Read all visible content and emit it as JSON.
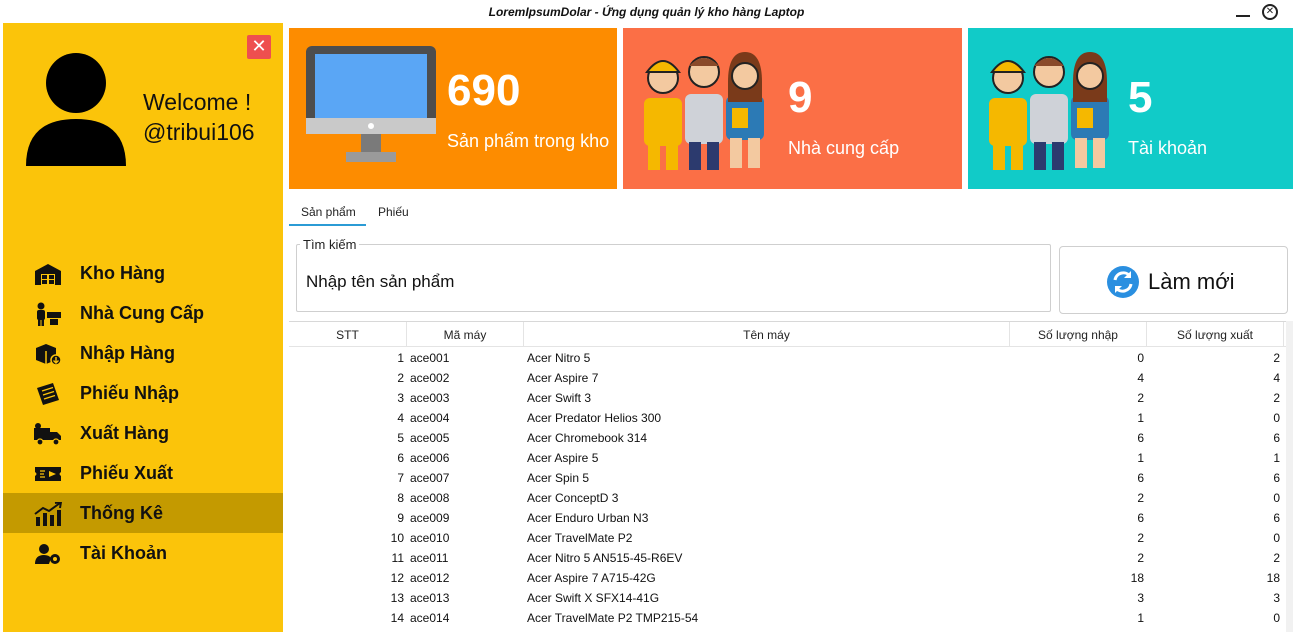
{
  "window": {
    "title": "LoremIpsumDolar - Ứng dụng quản lý kho hàng Laptop",
    "minimize_icon": "minimize-icon",
    "close_icon": "close-icon"
  },
  "sidebar": {
    "close_label": "✕",
    "welcome_line1": "Welcome !",
    "welcome_line2": "@tribui106",
    "items": [
      {
        "label": "Kho Hàng",
        "icon": "warehouse-icon"
      },
      {
        "label": "Nhà Cung Cấp",
        "icon": "supplier-icon"
      },
      {
        "label": "Nhập Hàng",
        "icon": "import-box-icon"
      },
      {
        "label": "Phiếu Nhập",
        "icon": "import-receipt-icon"
      },
      {
        "label": "Xuất Hàng",
        "icon": "delivery-truck-icon"
      },
      {
        "label": "Phiếu Xuất",
        "icon": "export-ticket-icon"
      },
      {
        "label": "Thống Kê",
        "icon": "statistics-chart-icon",
        "active": true
      },
      {
        "label": "Tài Khoản",
        "icon": "account-gear-icon"
      }
    ],
    "color": "#fbc40a",
    "active_color": "#c49a00"
  },
  "cards": [
    {
      "value": "690",
      "label": "Sản phẩm trong kho",
      "color": "#fd8c00",
      "icon": "monitor-icon"
    },
    {
      "value": "9",
      "label": "Nhà cung cấp",
      "color": "#fb6f46",
      "icon": "workers-group-icon"
    },
    {
      "value": "5",
      "label": "Tài khoản",
      "color": "#11cbc8",
      "icon": "workers-group-icon"
    }
  ],
  "tabs": [
    {
      "label": "Sản phẩm",
      "active": true
    },
    {
      "label": "Phiếu",
      "active": false
    }
  ],
  "search": {
    "legend": "Tìm kiếm",
    "value": "Nhập tên sản phẩm"
  },
  "refresh": {
    "label": "Làm mới",
    "icon": "refresh-icon",
    "icon_color": "#2a8fe0"
  },
  "table": {
    "columns": [
      "STT",
      "Mã máy",
      "Tên máy",
      "Số lượng nhập",
      "Số lượng xuất"
    ],
    "rows": [
      [
        "1",
        "ace001",
        "Acer Nitro 5",
        "0",
        "2"
      ],
      [
        "2",
        "ace002",
        "Acer Aspire 7",
        "4",
        "4"
      ],
      [
        "3",
        "ace003",
        "Acer Swift 3",
        "2",
        "2"
      ],
      [
        "4",
        "ace004",
        "Acer Predator Helios 300",
        "1",
        "0"
      ],
      [
        "5",
        "ace005",
        "Acer Chromebook 314",
        "6",
        "6"
      ],
      [
        "6",
        "ace006",
        "Acer Aspire 5",
        "1",
        "1"
      ],
      [
        "7",
        "ace007",
        "Acer Spin 5",
        "6",
        "6"
      ],
      [
        "8",
        "ace008",
        "Acer ConceptD 3",
        "2",
        "0"
      ],
      [
        "9",
        "ace009",
        "Acer Enduro Urban N3",
        "6",
        "6"
      ],
      [
        "10",
        "ace010",
        "Acer TravelMate P2",
        "2",
        "0"
      ],
      [
        "11",
        "ace011",
        "Acer Nitro 5 AN515-45-R6EV",
        "2",
        "2"
      ],
      [
        "12",
        "ace012",
        "Acer Aspire 7 A715-42G",
        "18",
        "18"
      ],
      [
        "13",
        "ace013",
        "Acer Swift X SFX14-41G",
        "3",
        "3"
      ],
      [
        "14",
        "ace014",
        "Acer TravelMate P2 TMP215-54",
        "1",
        "0"
      ]
    ]
  }
}
